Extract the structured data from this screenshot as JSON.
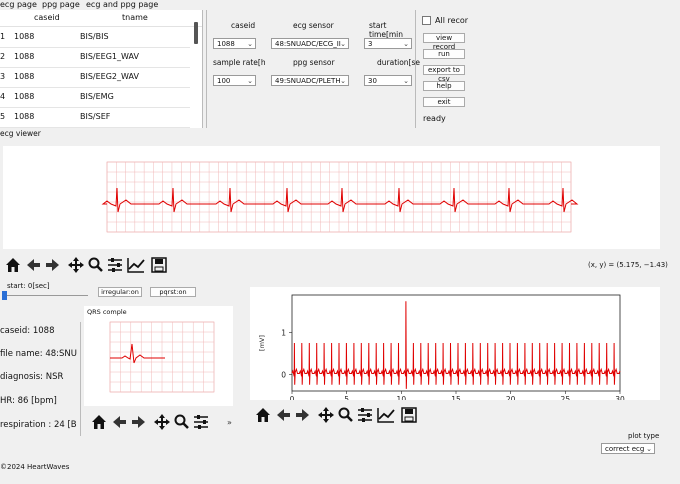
{
  "tabs": [
    "ecg page",
    "ppg page",
    "ecg and ppg page"
  ],
  "table": {
    "headers": [
      "caseid",
      "tname"
    ],
    "rows": [
      {
        "idx": "1",
        "caseid": "1088",
        "tname": "BIS/BIS"
      },
      {
        "idx": "2",
        "caseid": "1088",
        "tname": "BIS/EEG1_WAV"
      },
      {
        "idx": "3",
        "caseid": "1088",
        "tname": "BIS/EEG2_WAV"
      },
      {
        "idx": "4",
        "caseid": "1088",
        "tname": "BIS/EMG"
      },
      {
        "idx": "5",
        "caseid": "1088",
        "tname": "BIS/SEF"
      }
    ]
  },
  "controls": {
    "caseid_label": "caseid",
    "caseid_value": "1088",
    "ecg_sensor_label": "ecg sensor",
    "ecg_sensor_value": "48:SNUADC/ECG_II",
    "start_time_label": "start time[min",
    "start_time_value": "3",
    "sample_rate_label": "sample rate[h",
    "sample_rate_value": "100",
    "ppg_sensor_label": "ppg sensor",
    "ppg_sensor_value": "49:SNUADC/PLETH",
    "duration_label": "duration[se",
    "duration_value": "30"
  },
  "side": {
    "all_record_label": "All recor",
    "buttons": [
      "view record",
      "run",
      "export to csv",
      "help",
      "exit"
    ],
    "status": "ready"
  },
  "ecg_viewer_label": "ecg viewer",
  "coord_readout": "(x, y) = (5.175, −1.43)",
  "slider": {
    "label": "start: 0[sec]",
    "value": 0
  },
  "toggles": {
    "irregular": "irregular:on",
    "pqrst": "pqrst:on"
  },
  "info": {
    "caseid": "caseid: 1088",
    "file_name": "file name: 48:SNU",
    "diagnosis": "diagnosis: NSR",
    "hr": "HR: 86 [bpm]",
    "respiration": "respiration : 24 [B"
  },
  "qrs_label": "QRS comple",
  "chart_data": {
    "type": "line",
    "ylabel": "[mV]",
    "x_ticks": [
      "0",
      "5",
      "10",
      "15",
      "20",
      "25",
      "30"
    ],
    "y_ticks": [
      "1",
      "0"
    ],
    "xlim": [
      0,
      30
    ],
    "ylim": [
      -0.4,
      1.9
    ],
    "color": "#e00000"
  },
  "plot_type": {
    "label": "plot type",
    "value": "correct ecg"
  },
  "footer": "©2024 HeartWaves"
}
